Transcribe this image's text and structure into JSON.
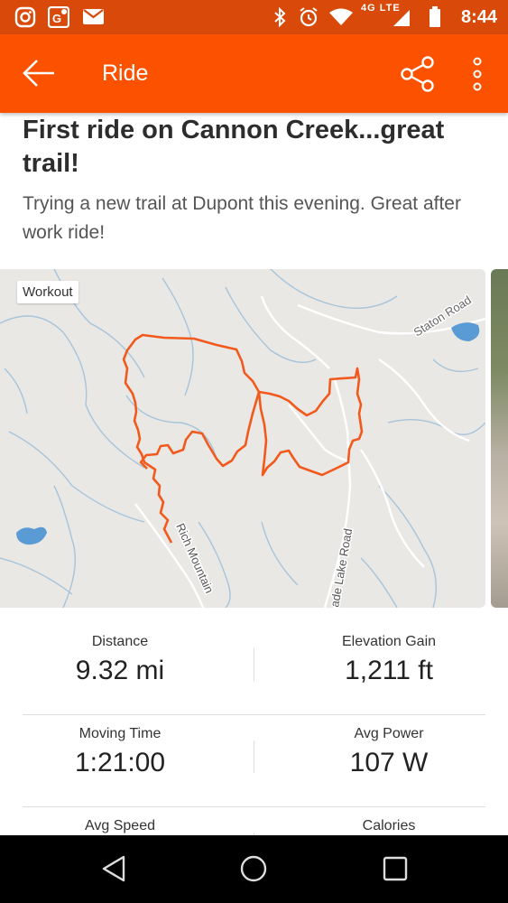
{
  "status_bar": {
    "time": "8:44",
    "network": "4G LTE",
    "icons": [
      "instagram-icon",
      "maps-icon",
      "gmail-icon",
      "bluetooth-icon",
      "alarm-icon",
      "wifi-icon",
      "signal-icon",
      "battery-icon"
    ]
  },
  "app_bar": {
    "title": "Ride",
    "back_icon": "arrow-left-icon",
    "share_icon": "share-icon",
    "menu_icon": "more-vert-icon"
  },
  "activity": {
    "title": "First ride on Cannon Creek...great trail!",
    "description": "Trying a new trail at Dupont this evening. Great after work ride!"
  },
  "map": {
    "badge": "Workout",
    "road_labels": {
      "staton": "Staton Road",
      "rich": "Rich Mountain",
      "cascade": "ade Lake Road"
    },
    "route_color": "#f2591c"
  },
  "stats": [
    {
      "left": {
        "label": "Distance",
        "value": "9.32 mi"
      },
      "right": {
        "label": "Elevation Gain",
        "value": "1,211 ft"
      }
    },
    {
      "left": {
        "label": "Moving Time",
        "value": "1:21:00"
      },
      "right": {
        "label": "Avg Power",
        "value": "107 W"
      }
    },
    {
      "left": {
        "label": "Avg Speed",
        "value": ""
      },
      "right": {
        "label": "Calories",
        "value": ""
      }
    }
  ],
  "colors": {
    "accent": "#fc5200",
    "status_bar": "#d94a0a"
  },
  "nav_bar": {
    "icons": [
      "back-triangle-icon",
      "home-circle-icon",
      "recents-square-icon"
    ]
  }
}
